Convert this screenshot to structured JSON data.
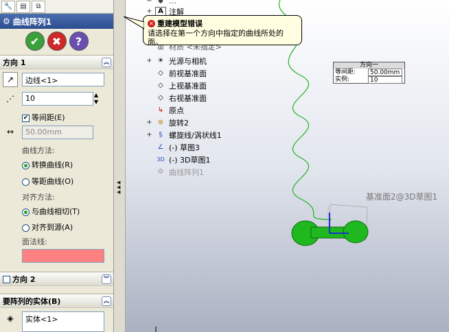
{
  "panel": {
    "title": "曲线阵列1",
    "dir1": {
      "title": "方向 1",
      "edge": "边线<1>",
      "count": "10",
      "equal_spacing": "等间距(E)",
      "spacing": "50.00mm",
      "curve_method_label": "曲线方法:",
      "opt_transform": "转换曲线(R)",
      "opt_offset": "等距曲线(O)",
      "align_label": "对齐方法:",
      "opt_tangent": "与曲线相切(T)",
      "opt_origin": "对齐到源(A)",
      "face_label": "面法线:"
    },
    "dir2": {
      "title": "方向 2"
    },
    "bodies": {
      "title": "要阵列的实体(B)",
      "item": "实体<1>"
    }
  },
  "tree": [
    {
      "label": "注解",
      "icon": "A"
    },
    {
      "label": "光源与相机",
      "icon": "light"
    },
    {
      "label": "前视基准面",
      "icon": "plane"
    },
    {
      "label": "上视基准面",
      "icon": "plane"
    },
    {
      "label": "右视基准面",
      "icon": "plane"
    },
    {
      "label": "原点",
      "icon": "origin"
    },
    {
      "label": "旋转2",
      "icon": "revolve"
    },
    {
      "label": "螺旋线/涡状线1",
      "icon": "helix"
    },
    {
      "label": "(-) 草图3",
      "icon": "sketch"
    },
    {
      "label": "(-) 3D草图1",
      "icon": "sketch3d"
    },
    {
      "label": "曲线阵列1",
      "icon": "pattern"
    }
  ],
  "tooltip": {
    "title": "重建模型错误",
    "body": "请选择在第一个方向中指定的曲线所处的面。"
  },
  "callout": {
    "title": "方向一",
    "spacing_label": "等间距:",
    "spacing_value": "50.00mm",
    "count_label": "实例:",
    "count_value": "10"
  },
  "viewport": {
    "plane_label": "基准面2@3D草图1",
    "partial_tree_item": "材质 <未指定>"
  },
  "colors": {
    "helix": "#22b022",
    "part": "#1fb81f",
    "field_red": "#ff8080",
    "title_bar": "#2c4c8e"
  }
}
